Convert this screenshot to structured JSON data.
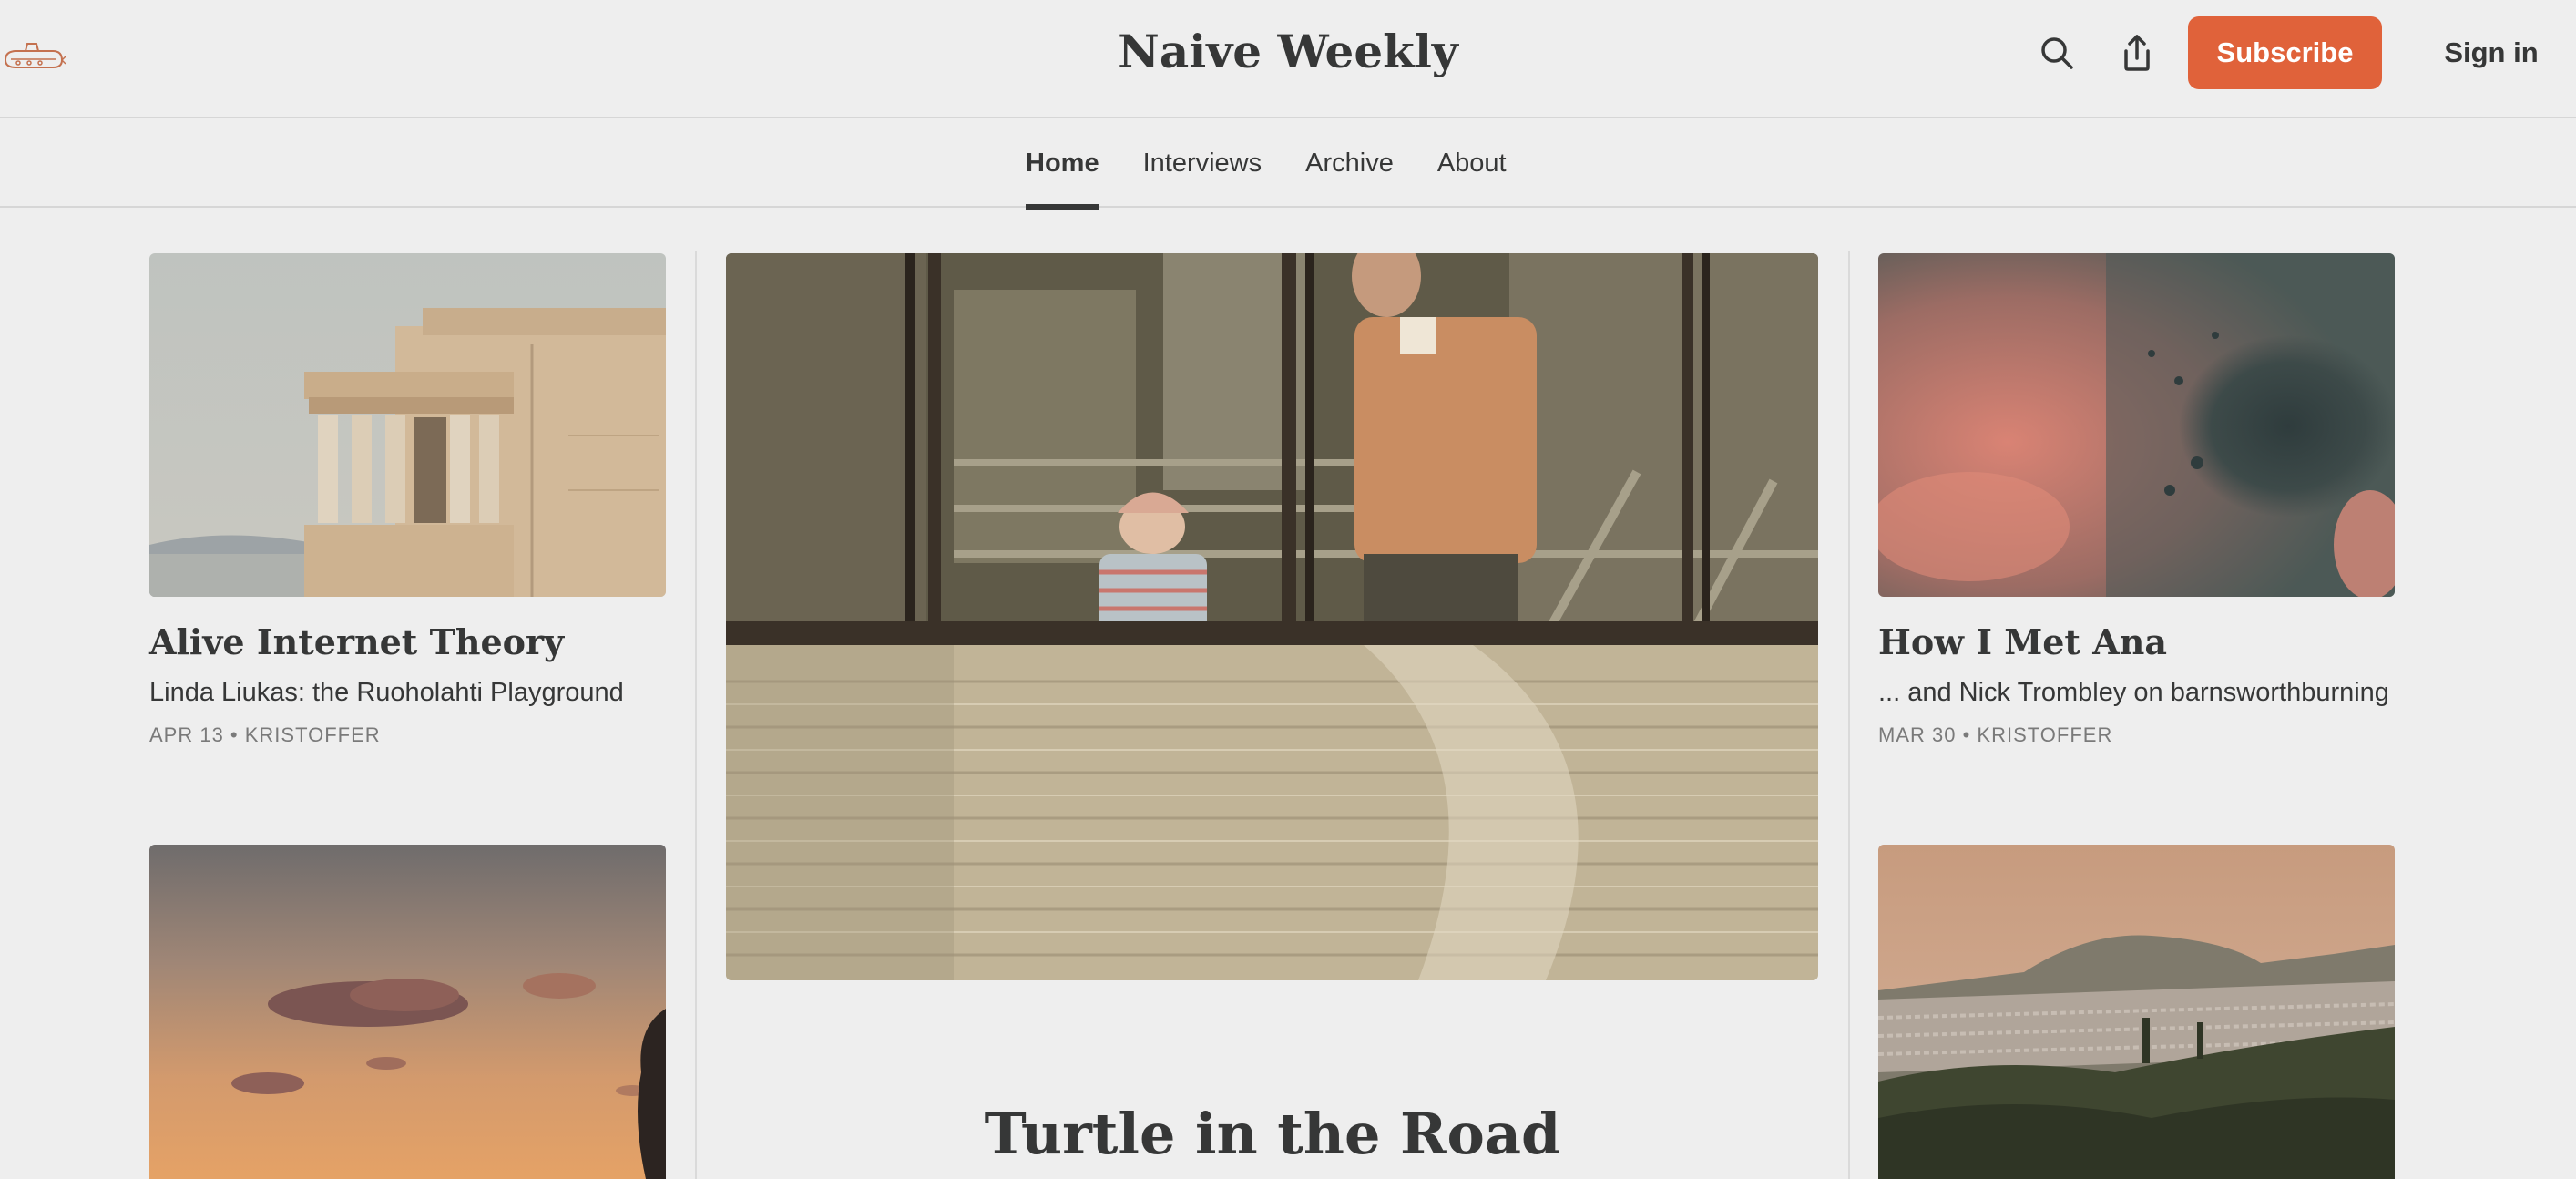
{
  "header": {
    "publication_title": "Naive Weekly",
    "logo_icon": "submarine-logo-icon",
    "search_icon": "search-icon",
    "share_icon": "share-icon",
    "subscribe_label": "Subscribe",
    "signin_label": "Sign in",
    "accent_color": "#e0623a"
  },
  "nav": {
    "tabs": [
      {
        "label": "Home",
        "active": true
      },
      {
        "label": "Interviews",
        "active": false
      },
      {
        "label": "Archive",
        "active": false
      },
      {
        "label": "About",
        "active": false
      }
    ]
  },
  "posts": {
    "left": [
      {
        "title": "Alive Internet Theory",
        "subtitle": "Linda Liukas: the Ruoholahti Playground",
        "meta": "APR 13 • KRISTOFFER",
        "image": "acropolis-caryatids-photo"
      },
      {
        "image": "sunset-clouds-photo"
      }
    ],
    "featured": {
      "title": "Turtle in the Road",
      "image": "child-and-man-behind-window-photo"
    },
    "right": [
      {
        "title": "How I Met Ana",
        "subtitle": "... and Nick Trombley on barnsworthburning",
        "meta": "MAR 30 • KRISTOFFER",
        "image": "abstract-pink-teal-photo"
      },
      {
        "image": "hillside-city-photo"
      }
    ]
  }
}
